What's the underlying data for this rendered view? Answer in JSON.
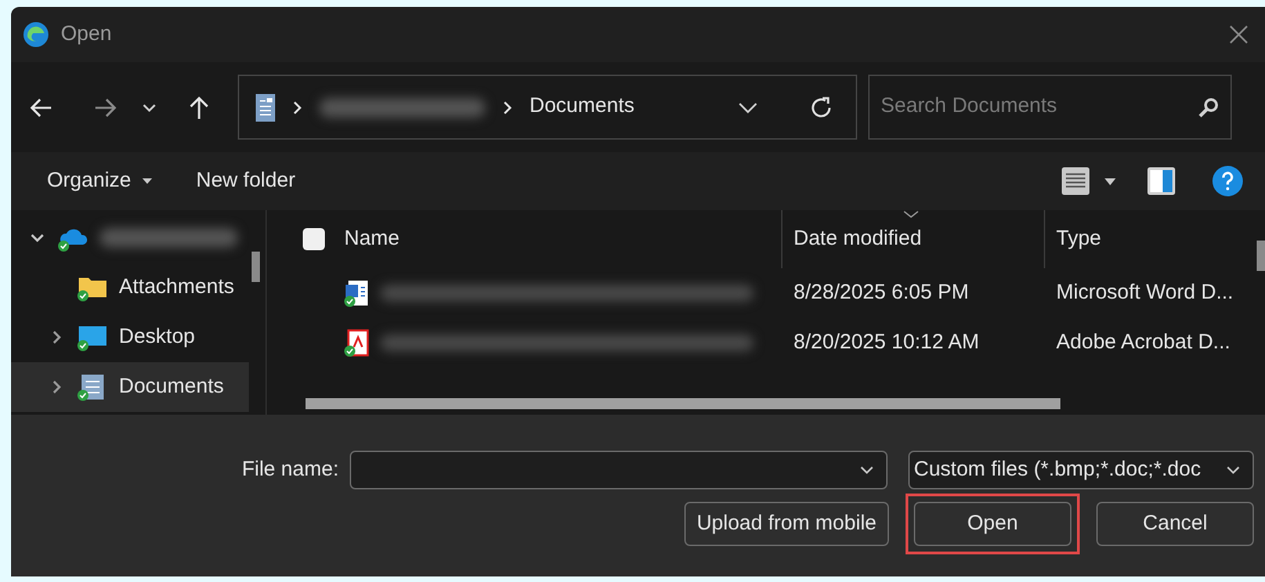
{
  "window": {
    "title": "Open"
  },
  "address_bar": {
    "crumbs": [
      "Documents"
    ]
  },
  "search": {
    "placeholder": "Search Documents"
  },
  "command_bar": {
    "items": [
      "Organize",
      "New folder"
    ]
  },
  "sidebar": {
    "items": [
      {
        "kind": "cloud",
        "expanded": true,
        "selected": false
      },
      {
        "kind": "folder",
        "label": "Attachments",
        "selected": false
      },
      {
        "kind": "desktop",
        "label": "Desktop",
        "expanded": false,
        "selected": false
      },
      {
        "kind": "documents",
        "label": "Documents",
        "expanded": false,
        "selected": true
      }
    ]
  },
  "file_list": {
    "select_all": {
      "checked": false
    },
    "columns": [
      "Name",
      "Date modified",
      "Type"
    ],
    "rows": [
      {
        "kind": "word",
        "date": "8/28/2025 6:05 PM",
        "type": "Microsoft Word D..."
      },
      {
        "kind": "pdf",
        "date": "8/20/2025 10:12 AM",
        "type": "Adobe Acrobat D..."
      }
    ]
  },
  "file_name": {
    "label": "File name:"
  },
  "file_type": {
    "value": "Custom files (*.bmp;*.doc;*.doc"
  },
  "buttons": [
    {
      "label": "Upload from mobile",
      "highlighted": false
    },
    {
      "label": "Open",
      "highlighted": true
    },
    {
      "label": "Cancel",
      "highlighted": false
    }
  ]
}
